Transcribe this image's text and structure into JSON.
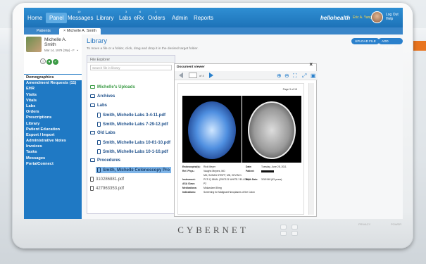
{
  "nav": {
    "items": [
      "Home",
      "Panel",
      "Messages",
      "Library",
      "Labs",
      "eRx",
      "Orders",
      "Admin",
      "Reports"
    ],
    "badges": {
      "messages": "10",
      "labs": "3",
      "erx": "6",
      "orders": "1"
    },
    "logo": "hellohealth",
    "user": "Eric A. Yang",
    "logout": "Log Out",
    "help": "Help"
  },
  "tabs": [
    "Patients",
    "Michelle A. Smith"
  ],
  "patient": {
    "name_line1": "Michelle A.",
    "name_line2": "Smith",
    "dob": "Mar 14, 1979 (39y) - F"
  },
  "sidebar": {
    "items": [
      "Demographics",
      "Amendment Requests (11)",
      "EHR",
      "Visits",
      "Vitals",
      "Labs",
      "Orders",
      "Prescriptions",
      "Library",
      "Patient Education",
      "Export / Import",
      "Administrative Notes",
      "Invoices",
      "Tasks",
      "Messages",
      "PortalConnect"
    ]
  },
  "library": {
    "title": "Library",
    "subtitle": "To move a file or a folder, click, drag and drop it in the desired target folder.",
    "upload_btn": "UPLOAD FILE",
    "add_folder_btn": "ADD FOLDER",
    "explorer_title": "File Explorer",
    "search_placeholder": "Search file in library",
    "tree": [
      "Michelle's Uploads",
      "Archives",
      "Labs",
      "Smith, Michelle Labs 3-4-11.pdf",
      "Smith, Michelle Labs 7-29-12.pdf",
      "Old Labs",
      "Smith, Michelle Labs 10-01-10.pdf",
      "Smith, Michelle Labs 10-1-10.pdf",
      "Procedures",
      "Smith, Michelle Colonoscopy Pro",
      "310286881.pdf",
      "427963353.pdf"
    ]
  },
  "viewer": {
    "title": "Document viewer",
    "page_of": "of 4",
    "page_label": "Page 3 of 15",
    "report": {
      "endoscopist_label": "Endoscopist(s):",
      "endoscopist": "Rick Meyer",
      "refphys_label": "Ref. Phys.:",
      "refphys": "Vaughn Meyers, MD",
      "refphys2": "MD, SUSAN STEIFF, MD, KEVIN D.",
      "instrument_label": "Instrument:",
      "instrument": "PCF-Q 180AL (2907121 WHITE-YELLOW)",
      "asa_label": "ASA Class:",
      "asa": "P2",
      "meds_label": "Medications:",
      "meds": "Midazolam 50mg",
      "indications_label": "Indications:",
      "indications": "Screening for Malignant Neoplasms of the Colon",
      "date_label": "Date:",
      "date": "Tuesday, June 28, 2011",
      "patient_label": "Patient:",
      "birth_label": "Birth Date:",
      "birth": "3/3/1948 (63 years)"
    }
  },
  "device": {
    "brand": "CYBERNET",
    "privacy": "PRIVACY",
    "power": "POWER"
  }
}
